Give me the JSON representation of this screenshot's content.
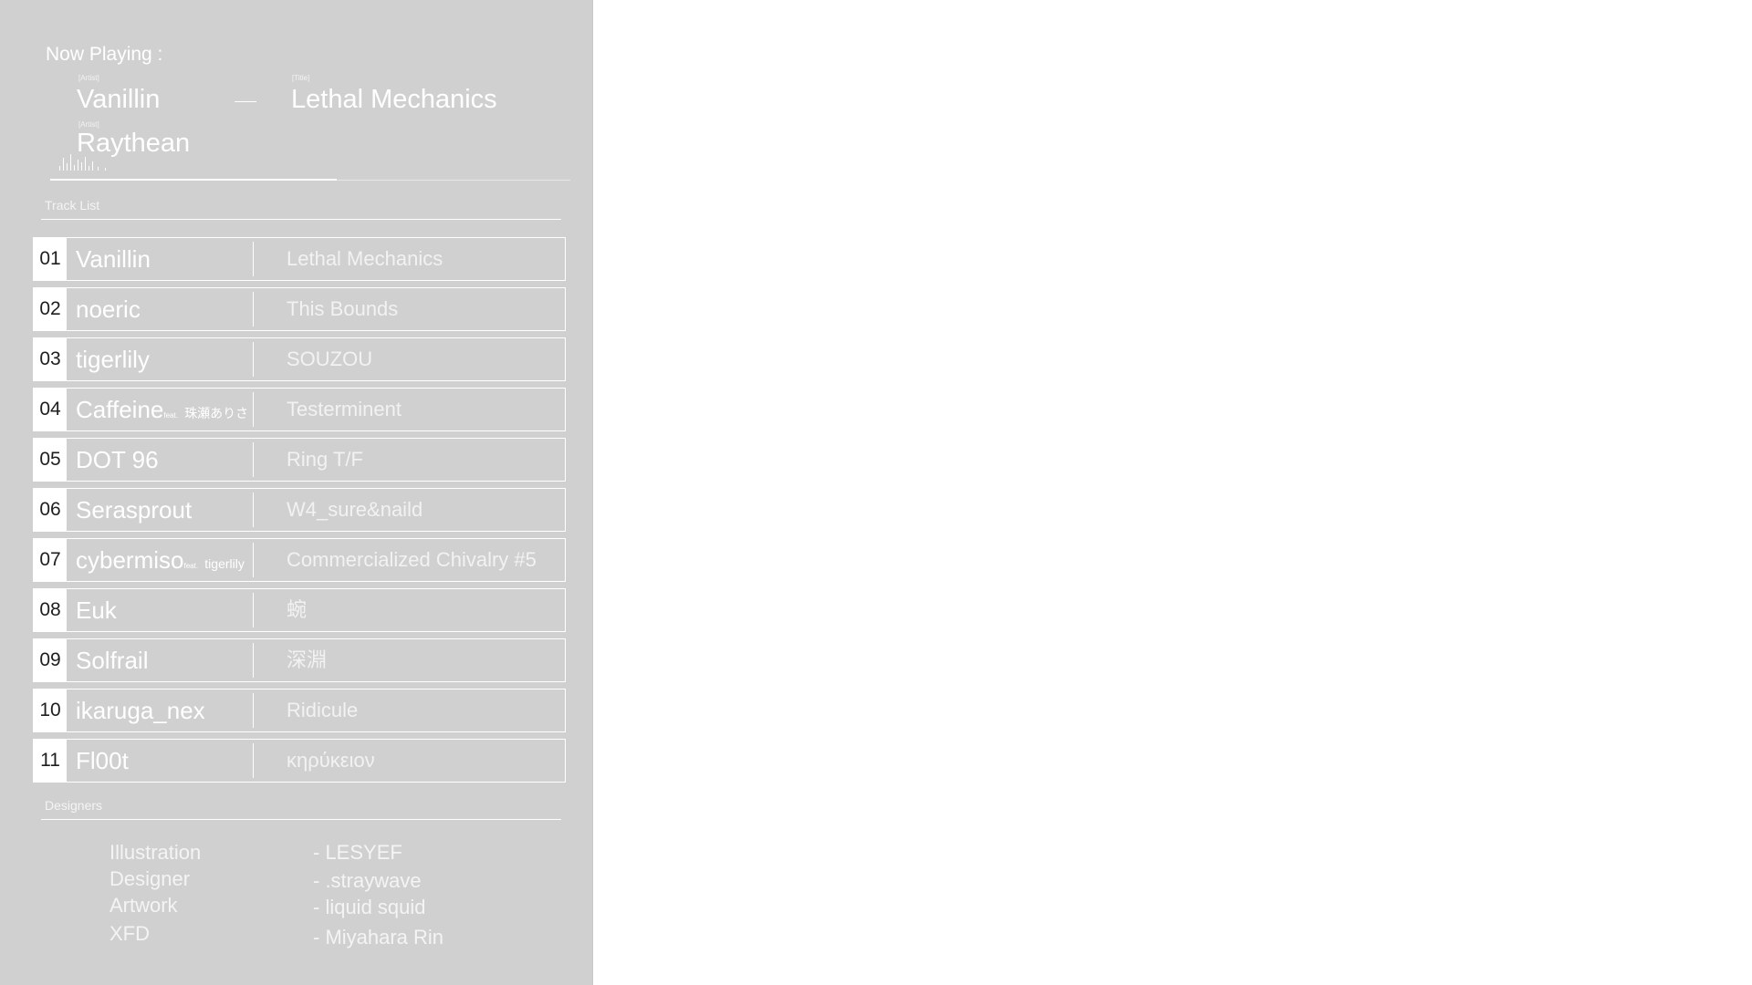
{
  "now_playing": {
    "label": "Now Playing :",
    "artist_caption": "[Artist]",
    "title_caption": "[Title]",
    "artist": "Vanillin",
    "artist2_caption": "[Artist]",
    "artist2": "Raythean",
    "title": "Lethal Mechanics",
    "progress": 0.55
  },
  "tracklist": {
    "label": "Track List",
    "tracks": [
      {
        "num": "01",
        "artist": "Vanillin",
        "title": "Lethal Mechanics"
      },
      {
        "num": "02",
        "artist": "noeric",
        "title": "This Bounds"
      },
      {
        "num": "03",
        "artist": "tigerlily",
        "title": "SOUZOU"
      },
      {
        "num": "04",
        "artist": "Caffeine",
        "feat_prefix": "feat.",
        "feat": "珠瀬ありさ",
        "title": "Testerminent"
      },
      {
        "num": "05",
        "artist": "DOT 96",
        "title": "Ring T/F"
      },
      {
        "num": "06",
        "artist": "Serasprout",
        "title": "W4_sure&naild"
      },
      {
        "num": "07",
        "artist": "cybermiso",
        "feat_prefix": "feat.",
        "feat": "tigerlily",
        "title": "Commercialized Chivalry #5"
      },
      {
        "num": "08",
        "artist": "Euk",
        "title": "蜿"
      },
      {
        "num": "09",
        "artist": "Solfrail",
        "title": "深淵"
      },
      {
        "num": "10",
        "artist": "ikaruga_nex",
        "title": "Ridicule"
      },
      {
        "num": "11",
        "artist": "Fl00t",
        "title": "κηρύκειον"
      }
    ]
  },
  "designers": {
    "label": "Designers",
    "credits": [
      {
        "role": "Illustration",
        "name": "- LESYEF"
      },
      {
        "role": "Designer",
        "name": "- .straywave"
      },
      {
        "role": "Artwork",
        "name": "- liquid squid"
      },
      {
        "role": "XFD",
        "name": "- Miyahara Rin"
      }
    ]
  }
}
